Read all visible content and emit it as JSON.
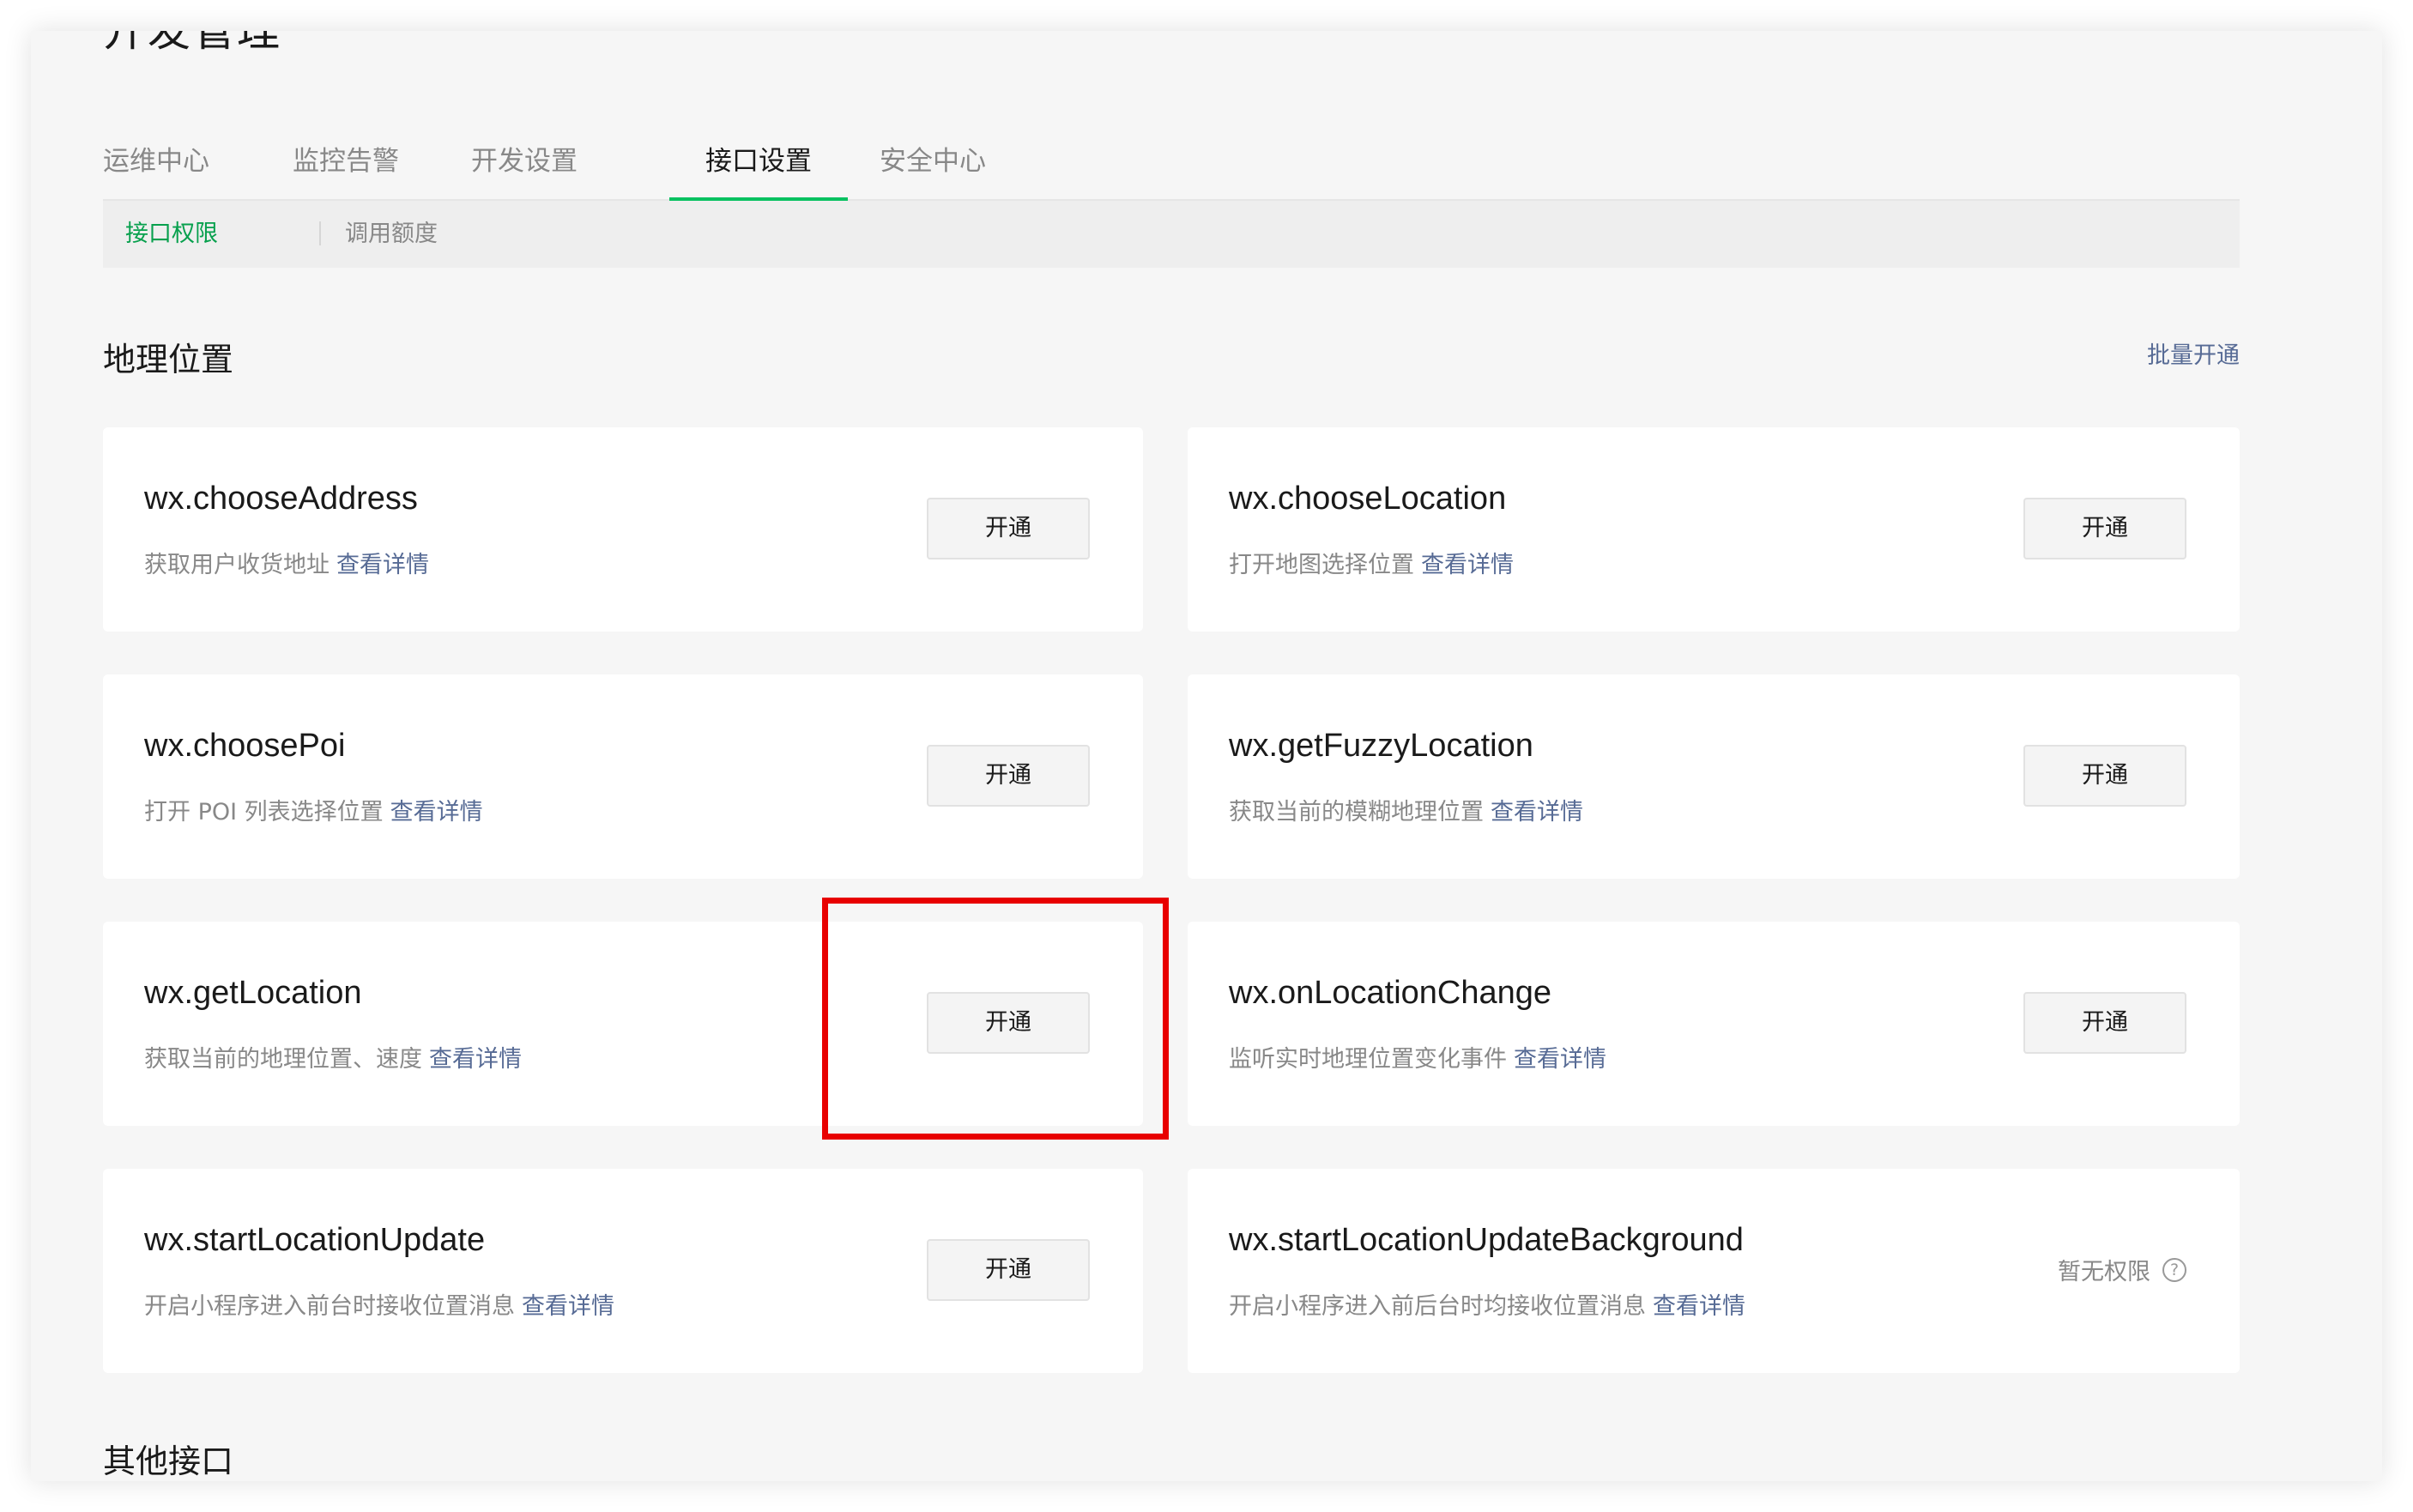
{
  "page": {
    "title": "开发管理"
  },
  "tabs": [
    {
      "label": "运维中心"
    },
    {
      "label": "监控告警"
    },
    {
      "label": "开发设置"
    },
    {
      "label": "接口设置"
    },
    {
      "label": "安全中心"
    }
  ],
  "active_tab": "接口设置",
  "subtabs": [
    {
      "label": "接口权限"
    },
    {
      "label": "调用额度"
    }
  ],
  "active_subtab": "接口权限",
  "section_location": {
    "title": "地理位置",
    "batch_label": "批量开通",
    "cards": [
      {
        "name": "wx.chooseAddress",
        "desc": "获取用户收货地址",
        "link": "查看详情",
        "action": "开通"
      },
      {
        "name": "wx.chooseLocation",
        "desc": "打开地图选择位置",
        "link": "查看详情",
        "action": "开通"
      },
      {
        "name": "wx.choosePoi",
        "desc": "打开 POI 列表选择位置",
        "link": "查看详情",
        "action": "开通"
      },
      {
        "name": "wx.getFuzzyLocation",
        "desc": "获取当前的模糊地理位置",
        "link": "查看详情",
        "action": "开通"
      },
      {
        "name": "wx.getLocation",
        "desc": "获取当前的地理位置、速度",
        "link": "查看详情",
        "action": "开通"
      },
      {
        "name": "wx.onLocationChange",
        "desc": "监听实时地理位置变化事件",
        "link": "查看详情",
        "action": "开通"
      },
      {
        "name": "wx.startLocationUpdate",
        "desc": "开启小程序进入前台时接收位置消息",
        "link": "查看详情",
        "action": "开通"
      },
      {
        "name": "wx.startLocationUpdateBackground",
        "desc": "开启小程序进入前后台时均接收位置消息",
        "link": "查看详情",
        "status": "暂无权限",
        "help_icon": "?"
      }
    ]
  },
  "section_other": {
    "title": "其他接口"
  },
  "colors": {
    "accent": "#07c160",
    "link": "#576b95",
    "highlight": "#e80000"
  }
}
